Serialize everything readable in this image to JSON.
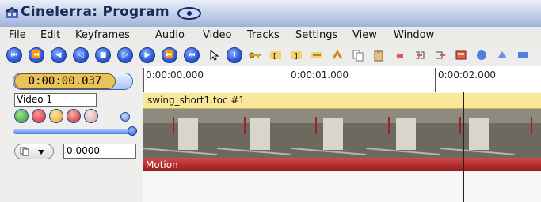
{
  "window": {
    "title": "Cinelerra: Program"
  },
  "menu": [
    "File",
    "Edit",
    "Keyframes",
    "Audio",
    "Video",
    "Tracks",
    "Settings",
    "View",
    "Window"
  ],
  "timecode": "0:00:00.037",
  "ruler": {
    "labels": [
      "0:00:00.000",
      "0:00:01.000",
      "0:00:02.000"
    ]
  },
  "track": {
    "name": "Video 1",
    "value": "0.0000",
    "edit_title": "swing_short1.toc #1",
    "automation_label": "Motion"
  },
  "colors": {
    "title_text": "#1c2c58",
    "timecode_bg": "#e9c25a",
    "edit_title_bg": "#f9e79a",
    "motion_bar": "#b82e2e",
    "accent": "#2f5fd8"
  },
  "icons": [
    "rewind-to-start-icon",
    "fast-reverse-icon",
    "reverse-icon",
    "frame-reverse-icon",
    "stop-icon",
    "frame-forward-icon",
    "play-icon",
    "fast-forward-icon",
    "jump-to-end-icon",
    "arrow-cursor-icon",
    "ibeam-cursor-icon",
    "keyframe-key-icon",
    "in-point-icon",
    "out-point-icon",
    "label-icon",
    "splice-icon",
    "copy-icon",
    "paste-icon",
    "undo-icon",
    "clip-icon",
    "overwrite-icon",
    "toggle-icon"
  ]
}
